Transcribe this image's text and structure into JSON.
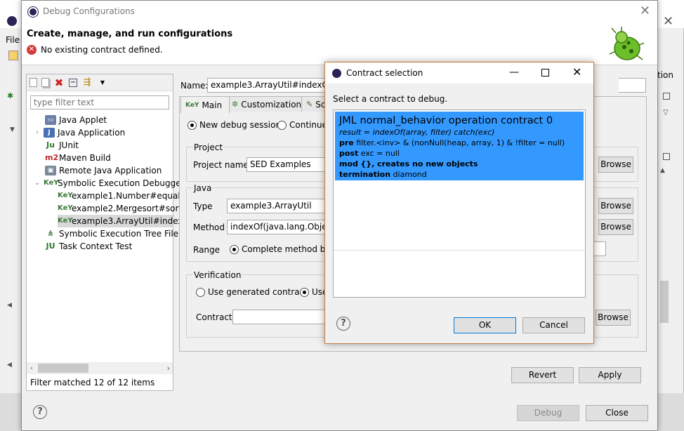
{
  "main_dialog": {
    "title": "Debug Configurations",
    "header_title": "Create, manage, and run configurations",
    "header_error": "No existing contract defined."
  },
  "background_window": {
    "menu_item": "File",
    "right_text": "tion"
  },
  "left_panel": {
    "filter_placeholder": "type filter text",
    "tree": [
      {
        "label": "Java Applet",
        "icon": "java-applet-icon"
      },
      {
        "label": "Java Application",
        "icon": "java-application-icon"
      },
      {
        "label": "JUnit",
        "icon": "junit-icon"
      },
      {
        "label": "Maven Build",
        "icon": "maven-icon"
      },
      {
        "label": "Remote Java Application",
        "icon": "remote-java-icon"
      },
      {
        "label": "Symbolic Execution Debugge",
        "icon": "key-icon"
      },
      {
        "label": "example1.Number#equals",
        "icon": "key-icon"
      },
      {
        "label": "example2.Mergesort#sort(",
        "icon": "key-icon"
      },
      {
        "label": "example3.ArrayUtil#indexO",
        "icon": "key-icon"
      },
      {
        "label": "Symbolic Execution Tree File",
        "icon": "tree-file-icon"
      },
      {
        "label": "Task Context Test",
        "icon": "task-context-icon"
      }
    ],
    "filter_status": "Filter matched 12 of 12 items"
  },
  "config": {
    "name_label": "Name:",
    "name_value": "example3.ArrayUtil#indexOf(ja",
    "tabs": [
      {
        "label": "Main",
        "icon": "key-icon"
      },
      {
        "label": "Customization",
        "icon": "customization-icon"
      },
      {
        "label": "Sc",
        "icon": "source-icon"
      }
    ],
    "debug_session": {
      "new_label": "New debug session",
      "continue_label": "Continue"
    },
    "project": {
      "group_label": "Project",
      "name_label": "Project name",
      "name_value": "SED Examples",
      "browse": "Browse"
    },
    "java": {
      "group_label": "Java",
      "type_label": "Type",
      "type_value": "example3.ArrayUtil",
      "method_label": "Method",
      "method_value": "indexOf(java.lang.Object[",
      "range_label": "Range",
      "range_option": "Complete method bod",
      "browse_type": "Browse",
      "browse_method": "Browse"
    },
    "verification": {
      "group_label": "Verification",
      "generated_label": "Use generated contract",
      "use_label": "Use",
      "contract_label": "Contract",
      "browse": "Browse"
    },
    "revert": "Revert",
    "apply": "Apply"
  },
  "footer": {
    "debug": "Debug",
    "close": "Close"
  },
  "contract_dialog": {
    "title": "Contract selection",
    "prompt": "Select a contract to debug.",
    "item": {
      "heading": "JML normal_behavior operation contract 0",
      "result_line": "result = indexOf(array, filter) catch(exc)",
      "pre_kw": "pre",
      "pre_text": "filter.<inv> & (nonNull(heap, array, 1) & !filter = null)",
      "post_kw": "post",
      "post_text": "exc = null",
      "mod_kw": "mod",
      "mod_text": "{}, creates no new objects",
      "termination_kw": "termination",
      "termination_text": "diamond"
    },
    "ok": "OK",
    "cancel": "Cancel"
  }
}
